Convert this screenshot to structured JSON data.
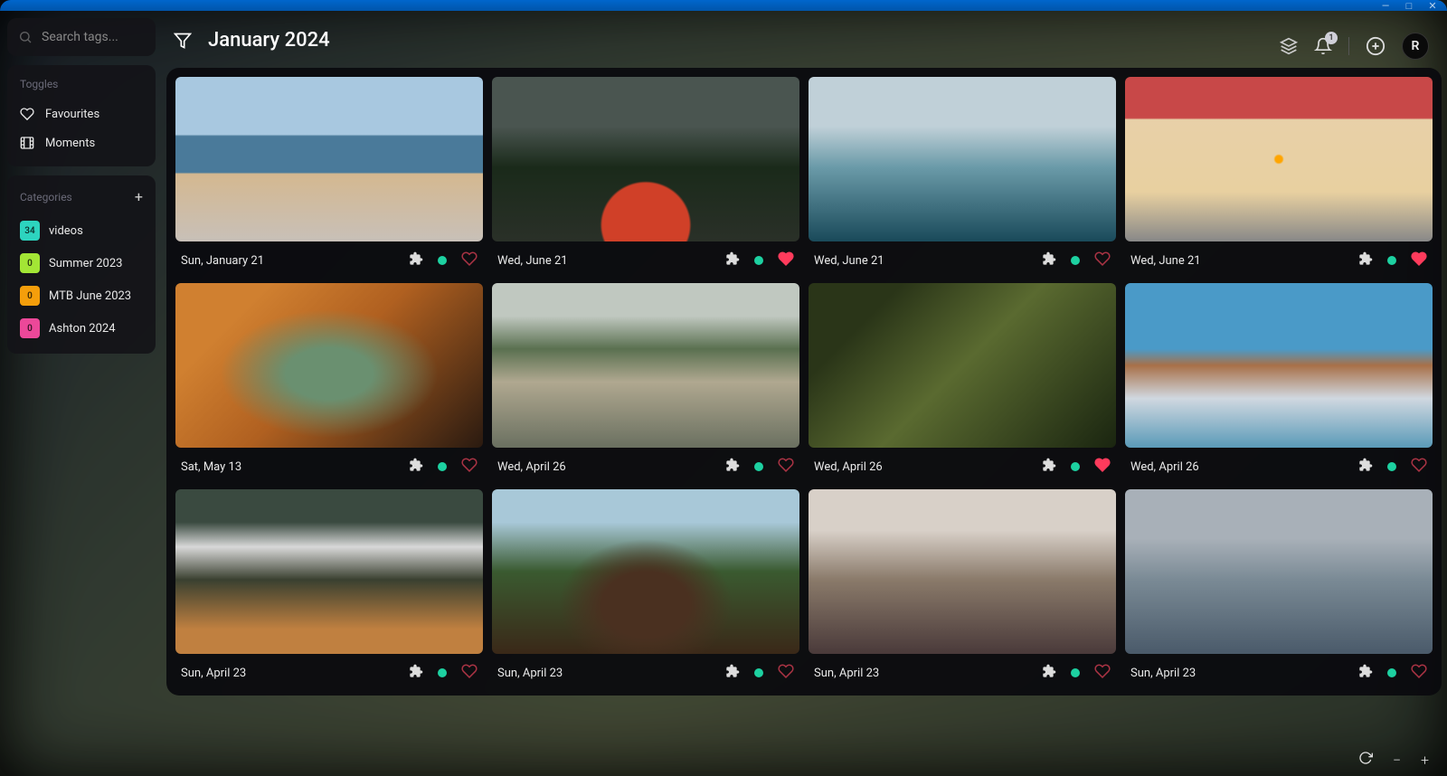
{
  "window": {
    "minimize": "—",
    "maximize": "□",
    "close": "✕"
  },
  "search": {
    "placeholder": "Search tags..."
  },
  "header": {
    "notification_count": "1",
    "avatar_initial": "R"
  },
  "sidebar": {
    "toggles_title": "Toggles",
    "toggles": [
      {
        "label": "Favourites",
        "icon": "heart"
      },
      {
        "label": "Moments",
        "icon": "film"
      }
    ],
    "categories_title": "Categories",
    "categories": [
      {
        "count": "34",
        "label": "videos",
        "color": "#2dd4bf"
      },
      {
        "count": "0",
        "label": "Summer 2023",
        "color": "#a3e635"
      },
      {
        "count": "0",
        "label": "MTB June 2023",
        "color": "#f59e0b"
      },
      {
        "count": "0",
        "label": "Ashton 2024",
        "color": "#ec4899"
      }
    ]
  },
  "page": {
    "title": "January 2024"
  },
  "cards": [
    {
      "date": "Sun, January 21",
      "fav": false,
      "thumb": "t-beach"
    },
    {
      "date": "Wed, June 21",
      "fav": true,
      "thumb": "t-kayak"
    },
    {
      "date": "Wed, June 21",
      "fav": false,
      "thumb": "t-paddle"
    },
    {
      "date": "Wed, June 21",
      "fav": true,
      "thumb": "t-cake"
    },
    {
      "date": "Sat, May 13",
      "fav": false,
      "thumb": "t-tent"
    },
    {
      "date": "Wed, April 26",
      "fav": false,
      "thumb": "t-hike"
    },
    {
      "date": "Wed, April 26",
      "fav": true,
      "thumb": "t-bike"
    },
    {
      "date": "Wed, April 26",
      "fav": false,
      "thumb": "t-dog"
    },
    {
      "date": "Sun, April 23",
      "fav": false,
      "thumb": "t-falls"
    },
    {
      "date": "Sun, April 23",
      "fav": false,
      "thumb": "t-mtb"
    },
    {
      "date": "Sun, April 23",
      "fav": false,
      "thumb": "t-friends"
    },
    {
      "date": "Sun, April 23",
      "fav": false,
      "thumb": "t-surf"
    }
  ],
  "colors": {
    "accent_dot": "#1dd1a1",
    "heart_on": "#ff3b5c",
    "heart_off": "#aa3344"
  }
}
